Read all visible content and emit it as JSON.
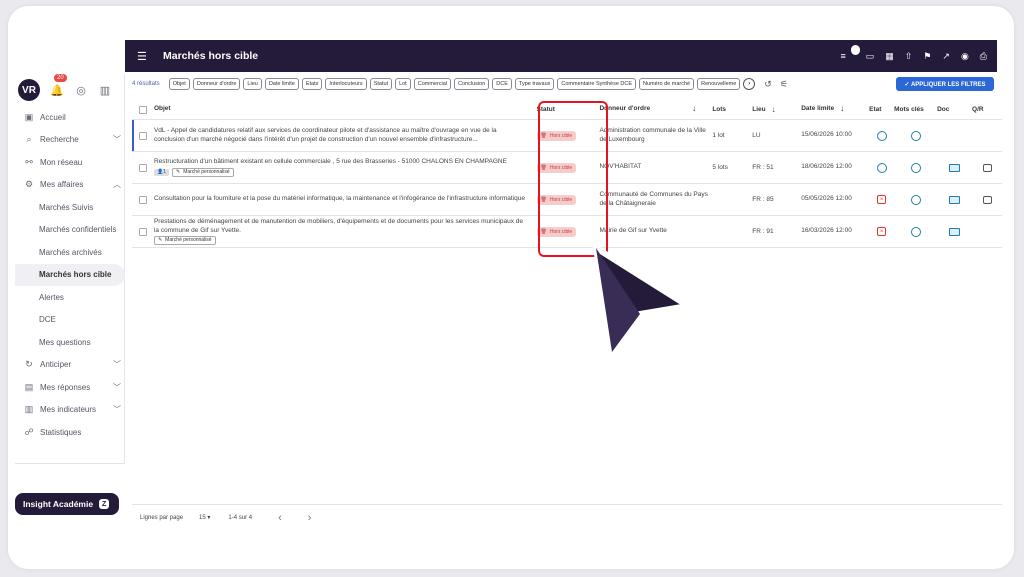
{
  "header": {
    "title": "Marchés hors cible",
    "notif_count": "0"
  },
  "user": {
    "initials": "VR",
    "notif_badge": "20"
  },
  "sidebar": {
    "items": [
      {
        "label": "Accueil",
        "icon": "home-icon"
      },
      {
        "label": "Recherche",
        "icon": "search-icon",
        "chevron": "down"
      },
      {
        "label": "Mon réseau",
        "icon": "network-icon"
      },
      {
        "label": "Mes affaires",
        "icon": "gear-icon",
        "chevron": "up"
      },
      {
        "label": "Marchés Suivis",
        "sub": true
      },
      {
        "label": "Marchés confidentiels",
        "sub": true
      },
      {
        "label": "Marchés archivés",
        "sub": true
      },
      {
        "label": "Marchés hors cible",
        "sub": true,
        "active": true
      },
      {
        "label": "Alertes",
        "sub": true
      },
      {
        "label": "DCE",
        "sub": true
      },
      {
        "label": "Mes questions",
        "sub": true
      },
      {
        "label": "Anticiper",
        "icon": "refresh-icon",
        "chevron": "down"
      },
      {
        "label": "Mes réponses",
        "icon": "file-icon",
        "chevron": "down"
      },
      {
        "label": "Mes indicateurs",
        "icon": "chart-icon",
        "chevron": "down"
      },
      {
        "label": "Statistiques",
        "icon": "stats-icon"
      }
    ],
    "academy_label": "Insight Académie"
  },
  "filters": {
    "count": "4 résultats",
    "chips": [
      "Objet",
      "Donneur d'ordre",
      "Lieu",
      "Date limite",
      "Etats",
      "Interlocuteurs",
      "Statut",
      "Lot",
      "Commercial",
      "Conclusion",
      "DCE",
      "Type travaux",
      "Commentaire Synthèse DCE",
      "Numéro de marché",
      "Renouvelleme"
    ],
    "apply_label": "✓ APPLIQUER LES FILTRES"
  },
  "table": {
    "headers": {
      "objet": "Objet",
      "statut": "Statut",
      "donneur": "Donneur d'ordre",
      "lots": "Lots",
      "lieu": "Lieu",
      "date": "Date limite",
      "etat": "Etat",
      "mots": "Mots clés",
      "doc": "Doc",
      "qr": "Q/R"
    },
    "rows": [
      {
        "objet": "VdL - Appel de candidatures relatif aux services de coordinateur pilote et d'assistance au maître d'ouvrage en vue de la conclusion d'un marché négocié dans l'intérêt d'un projet de construction d'un nouvel ensemble d'infrastructure...",
        "statut": "Hors cible",
        "donneur": "Administration communale de la Ville de Luxembourg",
        "lots": "1 lot",
        "lieu": "LU",
        "date": "15/06/2026 10:00",
        "etat": "clock",
        "doc": false,
        "qr": false,
        "tag": "",
        "tagnum": ""
      },
      {
        "objet": "Restructuration d'un bâtiment existant en cellule commerciale , 5 rue des Brasseries - 51000 CHALONS EN CHAMPAGNE",
        "statut": "Hors cible",
        "donneur": "NOV'HABITAT",
        "lots": "5 lots",
        "lieu": "FR : 51",
        "date": "18/06/2026 12:00",
        "etat": "clock",
        "doc": true,
        "qr": true,
        "tag": "Marché personnalisé",
        "tagnum": "1"
      },
      {
        "objet": "Consultation pour la fourniture et la pose du matériel informatique, la maintenance et l'infogérance de l'infrastructure informatique",
        "statut": "Hors cible",
        "donneur": "Communauté de Communes du Pays de la Châtaigneraie",
        "lots": "",
        "lieu": "FR : 85",
        "date": "05/05/2026 12:00",
        "etat": "calendar",
        "doc": true,
        "qr": true,
        "tag": "",
        "tagnum": ""
      },
      {
        "objet": "Prestations de déménagement et de manutention de mobiliers, d'équipements et de documents pour les services municipaux de la commune de Gif sur Yvette.",
        "statut": "Hors cible",
        "donneur": "Mairie de Gif sur Yvette",
        "lots": "",
        "lieu": "FR : 91",
        "date": "16/03/2026 12:00",
        "etat": "calendar",
        "doc": true,
        "qr": false,
        "tag": "Marché personnalisé",
        "tagnum": ""
      }
    ]
  },
  "footer": {
    "per_page_label": "Lignes par page",
    "per_page_value": "15",
    "range": "1-4 sur 4"
  },
  "colors": {
    "brand": "#241a3a",
    "accent": "#2c67d6",
    "highlight": "#e4141f"
  }
}
